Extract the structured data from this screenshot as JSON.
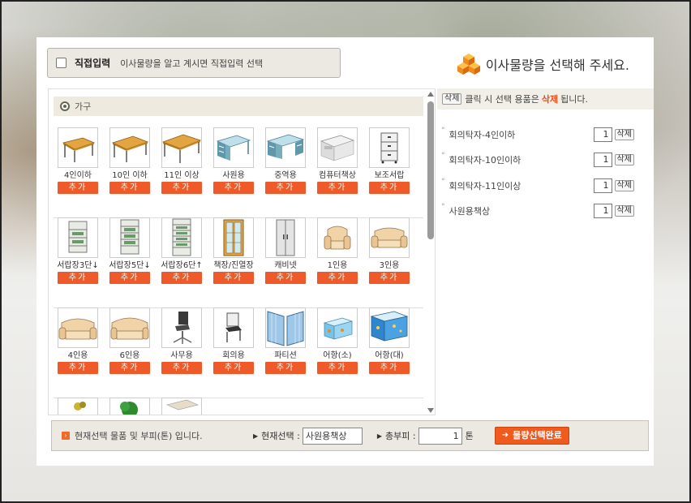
{
  "header": {
    "direct_input_label": "직접입력",
    "direct_input_desc": "이사물량을 알고 계시면 직접입력 선택",
    "title": "이사물량을 선택해 주세요."
  },
  "category": {
    "label": "가구"
  },
  "add_label": "추가",
  "items": [
    {
      "label": "4인이하",
      "icon": "table-icon"
    },
    {
      "label": "10인 이하",
      "icon": "table-icon"
    },
    {
      "label": "11인 이상",
      "icon": "table-icon"
    },
    {
      "label": "사원용",
      "icon": "office-desk-icon"
    },
    {
      "label": "중역용",
      "icon": "office-desk-icon"
    },
    {
      "label": "컴퓨터책상",
      "icon": "computer-desk-icon"
    },
    {
      "label": "보조서랍",
      "icon": "drawer-cabinet-icon"
    },
    {
      "label": "서랍장3단↓",
      "icon": "chest-of-drawers-icon"
    },
    {
      "label": "서랍장5단↓",
      "icon": "chest-of-drawers-icon"
    },
    {
      "label": "서랍장6단↑",
      "icon": "chest-of-drawers-icon"
    },
    {
      "label": "책장/진열장",
      "icon": "bookcase-icon"
    },
    {
      "label": "캐비넷",
      "icon": "cabinet-icon"
    },
    {
      "label": "1인용",
      "icon": "armchair-icon"
    },
    {
      "label": "3인용",
      "icon": "sofa-icon"
    },
    {
      "label": "4인용",
      "icon": "sofa-icon"
    },
    {
      "label": "6인용",
      "icon": "sofa-icon"
    },
    {
      "label": "사무용",
      "icon": "office-chair-icon"
    },
    {
      "label": "회의용",
      "icon": "meeting-chair-icon"
    },
    {
      "label": "파티션",
      "icon": "partition-icon"
    },
    {
      "label": "어항(소)",
      "icon": "fish-tank-icon"
    },
    {
      "label": "어항(대)",
      "icon": "fish-tank-icon"
    }
  ],
  "right": {
    "note_delete": "삭제",
    "note_pre": "클릭 시 선택 용품은",
    "note_strong": "삭제",
    "note_post": "됩니다.",
    "delete_label": "삭제",
    "selected": [
      {
        "name": "회의탁자-4인이하",
        "qty": "1"
      },
      {
        "name": "회의탁자-10인이하",
        "qty": "1"
      },
      {
        "name": "회의탁자-11인이상",
        "qty": "1"
      },
      {
        "name": "사원용책상",
        "qty": "1"
      }
    ]
  },
  "bottom": {
    "message": "현재선택 물품 및 부피(톤) 입니다.",
    "current_label": "현재선택 :",
    "current_value": "사원용책상",
    "volume_label": "총부피 :",
    "volume_value": "1",
    "unit": "톤",
    "done_label": "물량선택완료"
  },
  "colors": {
    "accent": "#ef5a2a",
    "panel_bar": "#ece8e2"
  }
}
